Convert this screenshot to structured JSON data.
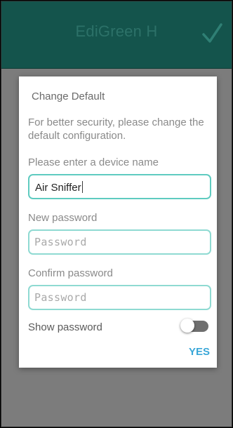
{
  "app_bar": {
    "title": "EdiGreen H",
    "confirm_icon": "check-icon"
  },
  "dialog": {
    "title": "Change Default",
    "message": "For better security, please change the default configuration.",
    "device_name": {
      "label": "Please enter a device name",
      "value": "Air Sniffer"
    },
    "new_password": {
      "label": "New password",
      "placeholder": "Password"
    },
    "confirm_password": {
      "label": "Confirm password",
      "placeholder": "Password"
    },
    "show_password": {
      "label": "Show password",
      "enabled": false
    },
    "yes_label": "YES"
  },
  "colors": {
    "app_bar": "#14544c",
    "accent_button": "#3aa7d8",
    "field_border": "#8fdad2",
    "overlay": "#7c7c7c"
  }
}
